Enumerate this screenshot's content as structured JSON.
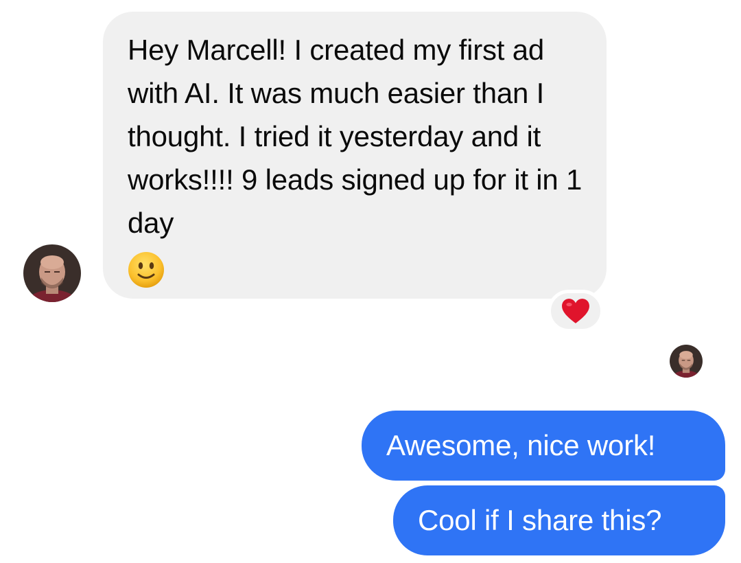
{
  "conversation": {
    "incoming": {
      "text": "Hey Marcell! I created my first ad with AI. It was much easier than I thought. I tried it yesterday and it works!!!! 9 leads signed up for it in 1 day",
      "emoji": "slightly-smiling-face",
      "reaction": "heart",
      "sender_avatar": "bald-man-avatar"
    },
    "read_receipt_avatar": "bald-man-avatar",
    "outgoing": [
      {
        "text": "Awesome, nice work!"
      },
      {
        "text": "Cool if I share this?"
      }
    ]
  },
  "colors": {
    "incoming_bubble": "#f0f0f0",
    "outgoing_bubble": "#2f74f5",
    "reaction_heart": "#e0142c",
    "background": "#ffffff"
  }
}
